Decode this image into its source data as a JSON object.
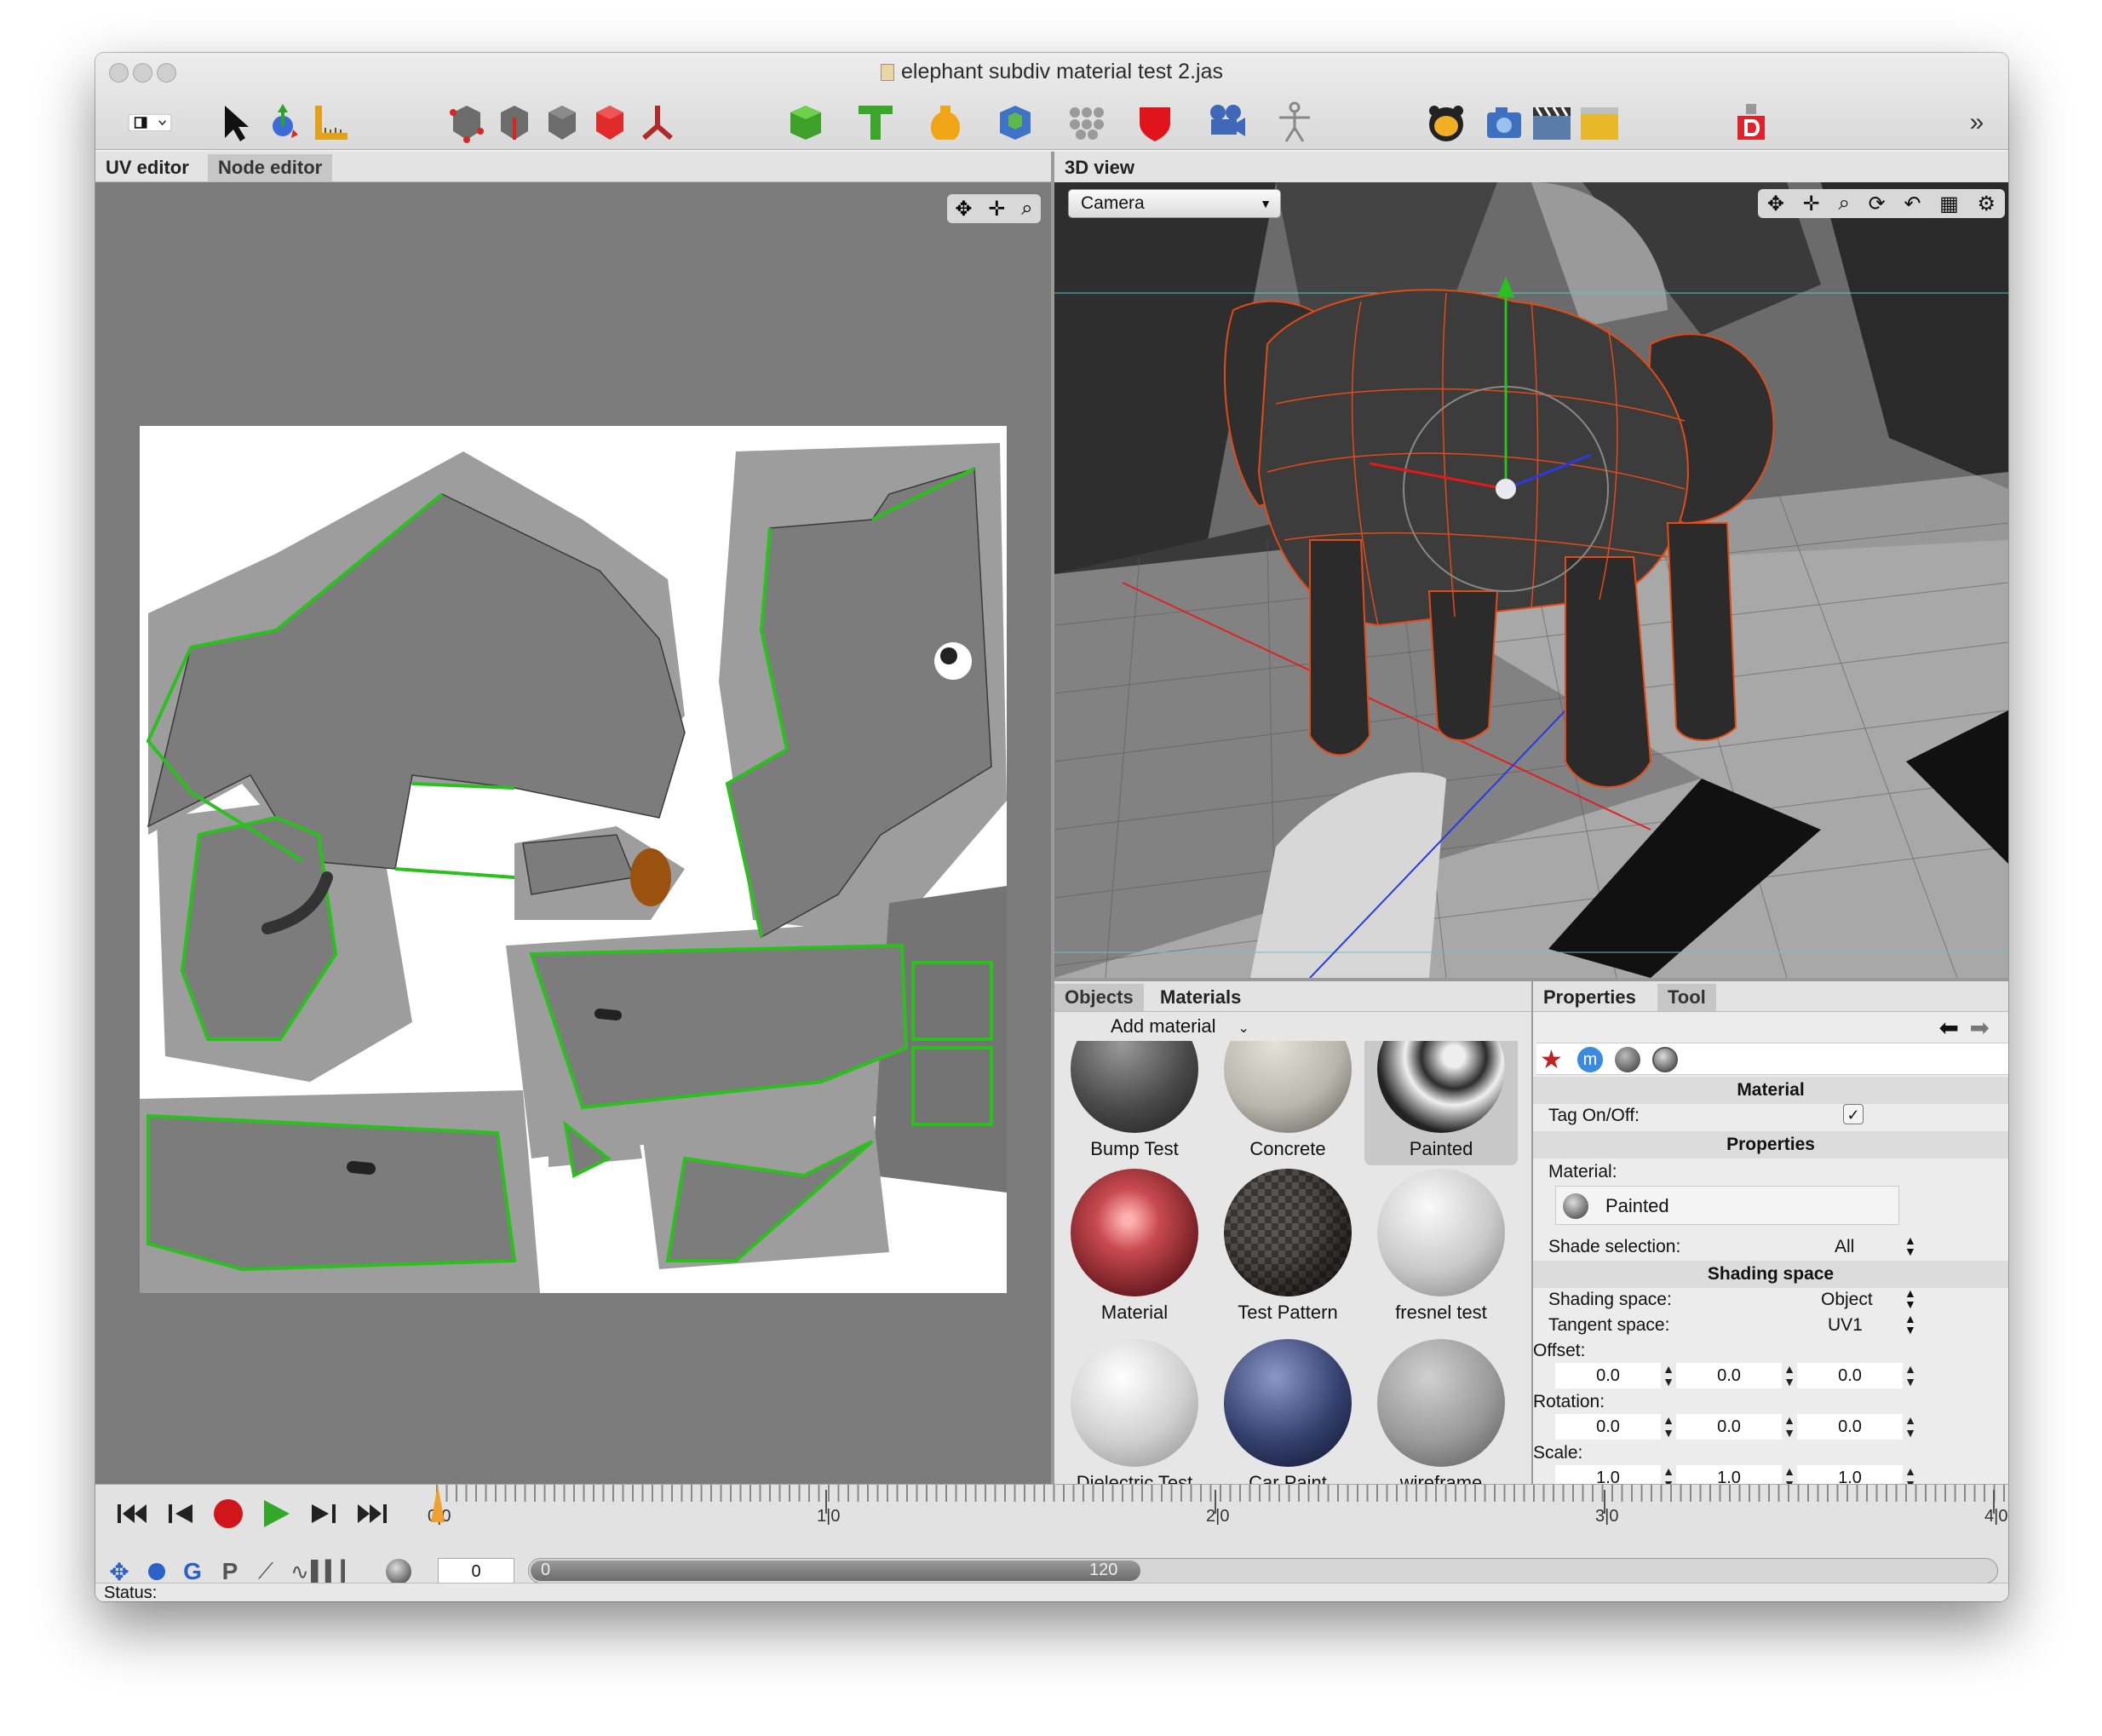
{
  "window": {
    "title": "elephant subdiv material test 2.jas"
  },
  "toolbar": {
    "tools": [
      "layout-icon",
      "arrow-select-icon",
      "transform-icon",
      "ruler-icon",
      "vertex-mode-icon",
      "edge-mode-icon",
      "face-mode-icon",
      "object-mode-icon",
      "skeleton-mode-icon",
      "cube-primitive-icon",
      "text-primitive-icon",
      "vase-primitive-icon",
      "subdiv-cube-icon",
      "particles-icon",
      "shield-deformer-icon",
      "camera-group-icon",
      "character-icon",
      "bear-render-icon",
      "camera-icon",
      "clapper-icon",
      "folder-icon",
      "dimension-icon"
    ],
    "overflow": "»"
  },
  "left_tabs": [
    {
      "label": "UV editor"
    },
    {
      "label": "Node editor"
    }
  ],
  "view3d": {
    "title": "3D view",
    "camera": "Camera"
  },
  "objects_tabs": [
    {
      "label": "Objects"
    },
    {
      "label": "Materials"
    }
  ],
  "add_material": "Add material",
  "materials": [
    {
      "name": "Bump Test",
      "color": "#4a4a4a"
    },
    {
      "name": "Concrete",
      "color": "#b9b6ad"
    },
    {
      "name": "Painted",
      "color": "#2c2c2c"
    },
    {
      "name": "Material",
      "color": "#9b2e34"
    },
    {
      "name": "Test Pattern",
      "color": "#4a4646"
    },
    {
      "name": "fresnel test",
      "color": "#c9c9c9"
    },
    {
      "name": "Dielectric Test",
      "color": "#cfcfcf"
    },
    {
      "name": "Car Paint",
      "color": "#34406e"
    },
    {
      "name": "wireframe",
      "color": "#9a9a9a"
    }
  ],
  "properties": {
    "tabs": [
      {
        "label": "Properties"
      },
      {
        "label": "Tool"
      }
    ],
    "section_material": "Material",
    "tag_label": "Tag On/Off:",
    "tag_on": "✓",
    "section_properties": "Properties",
    "material_label": "Material:",
    "material_value": "Painted",
    "shade_selection_label": "Shade selection:",
    "shade_selection_value": "All",
    "section_shading": "Shading space",
    "shading_space_label": "Shading space:",
    "shading_space_value": "Object",
    "tangent_space_label": "Tangent space:",
    "tangent_space_value": "UV1",
    "offset_label": "Offset:",
    "offset": [
      "0.0",
      "0.0",
      "0.0"
    ],
    "rotation_label": "Rotation:",
    "rotation": [
      "0.0",
      "0.0",
      "0.0"
    ],
    "scale_label": "Scale:",
    "scale": [
      "1.0",
      "1.0",
      "1.0"
    ]
  },
  "timeline": {
    "marks": [
      "0|0",
      "1|0",
      "2|0",
      "3|0",
      "4|0"
    ],
    "frame": "0",
    "range_start": "0",
    "range_end": "120"
  },
  "status": {
    "label": "Status:"
  },
  "colors": {
    "accent_green": "#27c01e",
    "selection_orange": "#e84a16",
    "record_red": "#d0161b",
    "play_green": "#32a82a"
  }
}
